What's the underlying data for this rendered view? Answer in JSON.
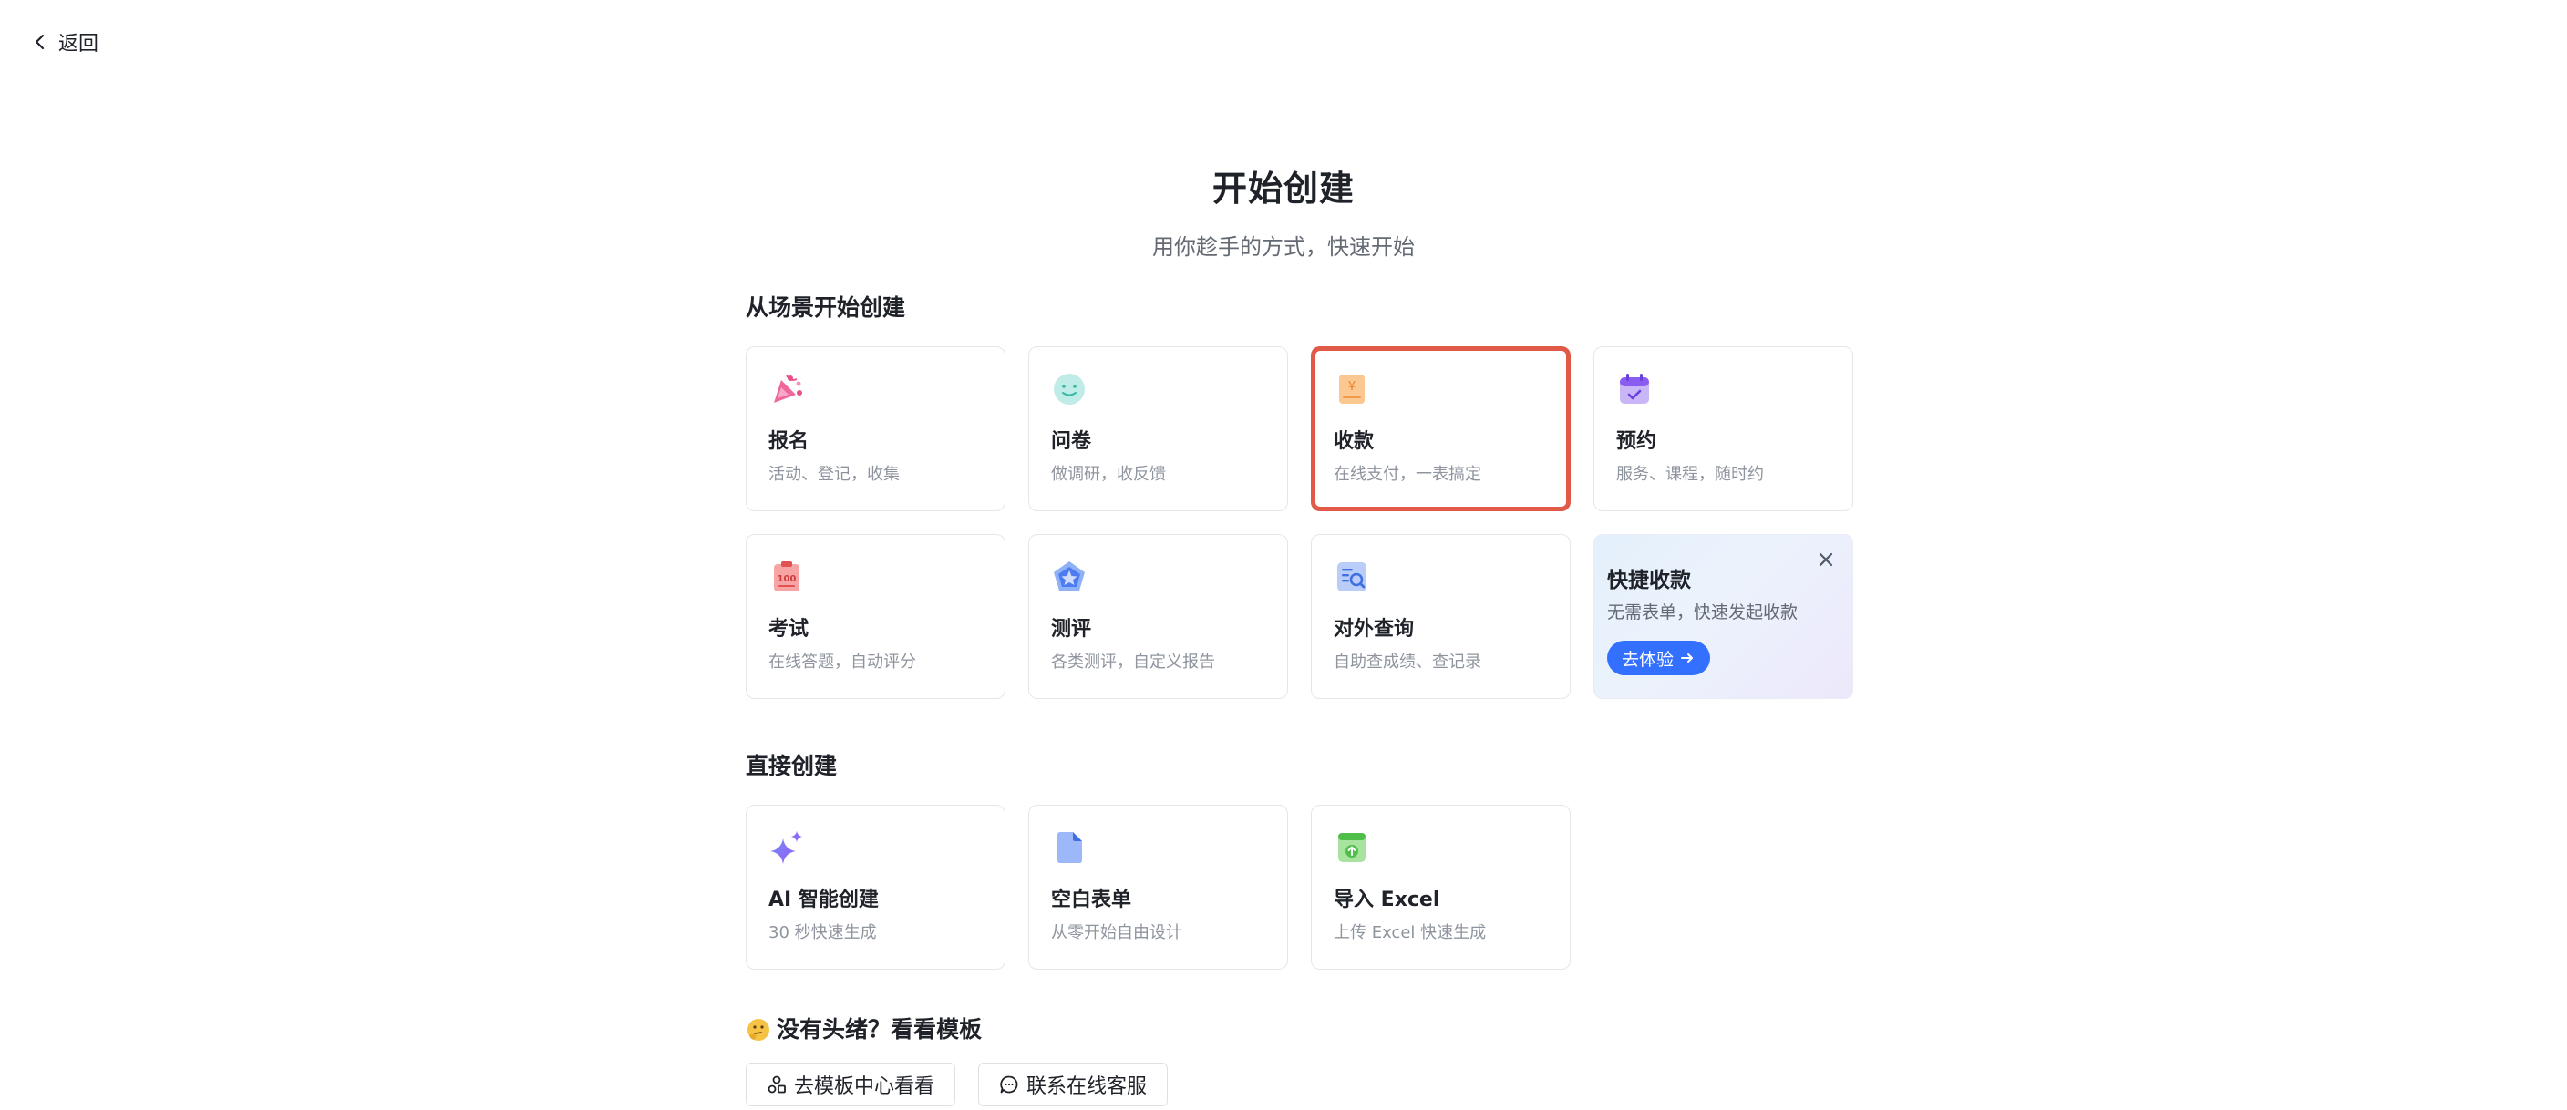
{
  "nav": {
    "back_label": "返回"
  },
  "header": {
    "title": "开始创建",
    "subtitle": "用你趁手的方式，快速开始"
  },
  "scenario_section": {
    "title": "从场景开始创建",
    "cards": [
      {
        "title": "报名",
        "desc": "活动、登记，收集",
        "icon": "party-popper-icon"
      },
      {
        "title": "问卷",
        "desc": "做调研，收反馈",
        "icon": "smiley-face-icon"
      },
      {
        "title": "收款",
        "desc": "在线支付，一表搞定",
        "icon": "yuan-receipt-icon",
        "selected": true
      },
      {
        "title": "预约",
        "desc": "服务、课程，随时约",
        "icon": "calendar-check-icon"
      },
      {
        "title": "考试",
        "desc": "在线答题，自动评分",
        "icon": "exam-score-icon"
      },
      {
        "title": "测评",
        "desc": "各类测评，自定义报告",
        "icon": "pentagon-star-icon"
      },
      {
        "title": "对外查询",
        "desc": "自助查成绩、查记录",
        "icon": "search-document-icon"
      }
    ],
    "promo": {
      "title": "快捷收款",
      "desc": "无需表单，快速发起收款",
      "button_label": "去体验"
    }
  },
  "direct_section": {
    "title": "直接创建",
    "cards": [
      {
        "title": "AI 智能创建",
        "desc": "30 秒快速生成",
        "icon": "ai-sparkle-icon"
      },
      {
        "title": "空白表单",
        "desc": "从零开始自由设计",
        "icon": "blank-document-icon"
      },
      {
        "title": "导入 Excel",
        "desc": "上传 Excel 快速生成",
        "icon": "excel-upload-icon"
      }
    ]
  },
  "template_section": {
    "title": "没有头绪？看看模板",
    "links": [
      {
        "label": "去模板中心看看",
        "icon": "shapes-icon"
      },
      {
        "label": "联系在线客服",
        "icon": "chat-bubble-icon"
      }
    ]
  },
  "colors": {
    "accent": "#3370ff",
    "selected_border": "#e05a47",
    "card_border": "#e4e6ea"
  }
}
